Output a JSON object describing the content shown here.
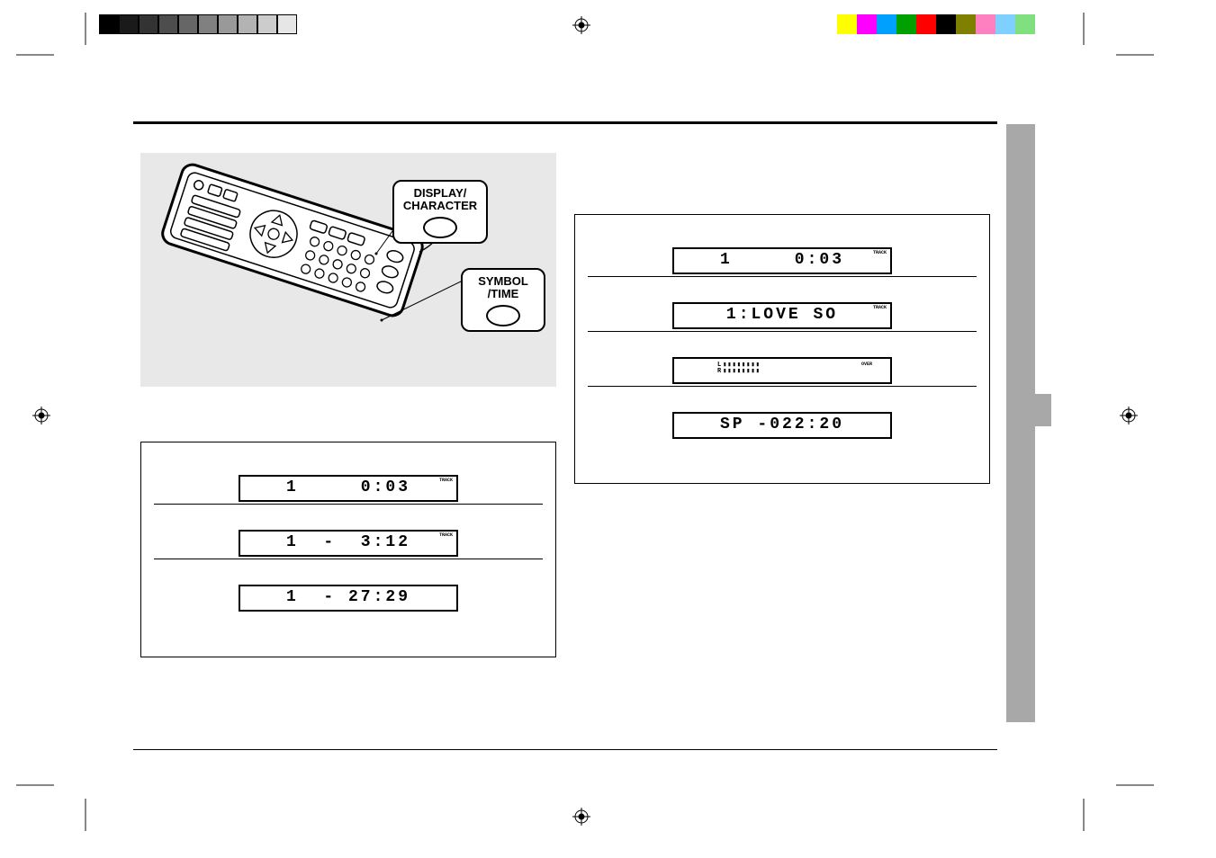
{
  "callouts": {
    "display_character": "DISPLAY/\nCHARACTER",
    "symbol_time": "SYMBOL\n/TIME"
  },
  "cd_panel": {
    "rows": [
      {
        "text": "1     0:03",
        "tag": "TRACK"
      },
      {
        "text": "1  -  3:12",
        "tag": "TRACK"
      },
      {
        "text": "1  - 27:29",
        "tag": ""
      }
    ]
  },
  "md_panel": {
    "rows": [
      {
        "text": "1     0:03",
        "tag": "TRACK",
        "type": "text"
      },
      {
        "text": "1:LOVE SO",
        "tag": "TRACK",
        "type": "text"
      },
      {
        "text": "",
        "tag": "OVER",
        "type": "meter"
      },
      {
        "text": "SP -022:20",
        "tag": "",
        "type": "text"
      }
    ]
  },
  "meter": {
    "L": "L",
    "R": "R",
    "bars": "▮▮▮▮▮▮▮▮"
  },
  "grayscale": [
    "#000000",
    "#1a1a1a",
    "#333333",
    "#4d4d4d",
    "#666666",
    "#808080",
    "#999999",
    "#b3b3b3",
    "#cccccc",
    "#e6e6e6"
  ],
  "colors": [
    "#ffff00",
    "#ff00ff",
    "#00a0ff",
    "#00a000",
    "#ff0000",
    "#000000",
    "#808000",
    "#ff80c0",
    "#80d0ff",
    "#80e080"
  ]
}
